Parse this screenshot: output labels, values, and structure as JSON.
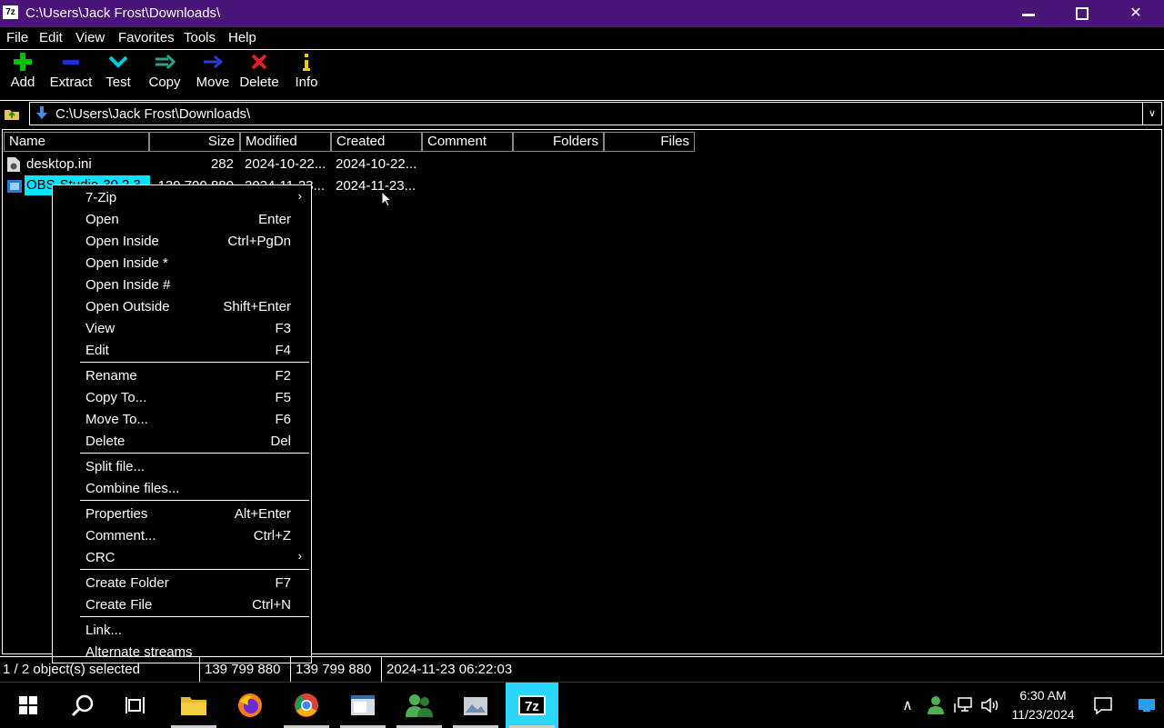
{
  "window": {
    "app_icon_text": "7z",
    "title": "C:\\Users\\Jack Frost\\Downloads\\"
  },
  "menubar": [
    "File",
    "Edit",
    "View",
    "Favorites",
    "Tools",
    "Help"
  ],
  "toolbar": [
    {
      "label": "Add",
      "icon": "plus-icon"
    },
    {
      "label": "Extract",
      "icon": "minus-icon"
    },
    {
      "label": "Test",
      "icon": "check-icon"
    },
    {
      "label": "Copy",
      "icon": "copy-arrows-icon"
    },
    {
      "label": "Move",
      "icon": "move-arrow-icon"
    },
    {
      "label": "Delete",
      "icon": "delete-x-icon"
    },
    {
      "label": "Info",
      "icon": "info-icon"
    }
  ],
  "address": {
    "path": "C:\\Users\\Jack Frost\\Downloads\\"
  },
  "columns": [
    "Name",
    "Size",
    "Modified",
    "Created",
    "Comment",
    "Folders",
    "Files"
  ],
  "files": [
    {
      "name": "desktop.ini",
      "size": "282",
      "modified": "2024-10-22...",
      "created": "2024-10-22..."
    },
    {
      "name": "OBS-Studio-30.2.3...",
      "size": "139 799 880",
      "modified": "2024-11-23...",
      "created": "2024-11-23..."
    }
  ],
  "context_menu": {
    "groups": [
      [
        {
          "label": "7-Zip",
          "shortcut": "",
          "submenu": true
        },
        {
          "label": "Open",
          "shortcut": "Enter"
        },
        {
          "label": "Open Inside",
          "shortcut": "Ctrl+PgDn"
        },
        {
          "label": "Open Inside *",
          "shortcut": ""
        },
        {
          "label": "Open Inside #",
          "shortcut": ""
        },
        {
          "label": "Open Outside",
          "shortcut": "Shift+Enter"
        },
        {
          "label": "View",
          "shortcut": "F3"
        },
        {
          "label": "Edit",
          "shortcut": "F4"
        }
      ],
      [
        {
          "label": "Rename",
          "shortcut": "F2"
        },
        {
          "label": "Copy To...",
          "shortcut": "F5"
        },
        {
          "label": "Move To...",
          "shortcut": "F6"
        },
        {
          "label": "Delete",
          "shortcut": "Del"
        }
      ],
      [
        {
          "label": "Split file...",
          "shortcut": ""
        },
        {
          "label": "Combine files...",
          "shortcut": ""
        }
      ],
      [
        {
          "label": "Properties",
          "shortcut": "Alt+Enter"
        },
        {
          "label": "Comment...",
          "shortcut": "Ctrl+Z"
        },
        {
          "label": "CRC",
          "shortcut": "",
          "submenu": true
        }
      ],
      [
        {
          "label": "Create Folder",
          "shortcut": "F7"
        },
        {
          "label": "Create File",
          "shortcut": "Ctrl+N"
        }
      ],
      [
        {
          "label": "Link...",
          "shortcut": ""
        },
        {
          "label": "Alternate streams",
          "shortcut": ""
        }
      ]
    ]
  },
  "status": {
    "selection": "1 / 2 object(s) selected",
    "size1": "139 799 880",
    "size2": "139 799 880",
    "date": "2024-11-23 06:22:03"
  },
  "taskbar": {
    "apps": [
      "start-icon",
      "search-icon",
      "task-view-icon",
      "file-explorer-icon",
      "firefox-icon",
      "chrome-icon",
      "app-window-icon",
      "users-icon",
      "photo-viewer-icon",
      "7zip-icon"
    ],
    "time": "6:30 AM",
    "date": "11/23/2024"
  },
  "colors": {
    "titlebar": "#4b1478",
    "selection": "#00e5ff",
    "background": "#000000",
    "foreground": "#ffffff"
  }
}
